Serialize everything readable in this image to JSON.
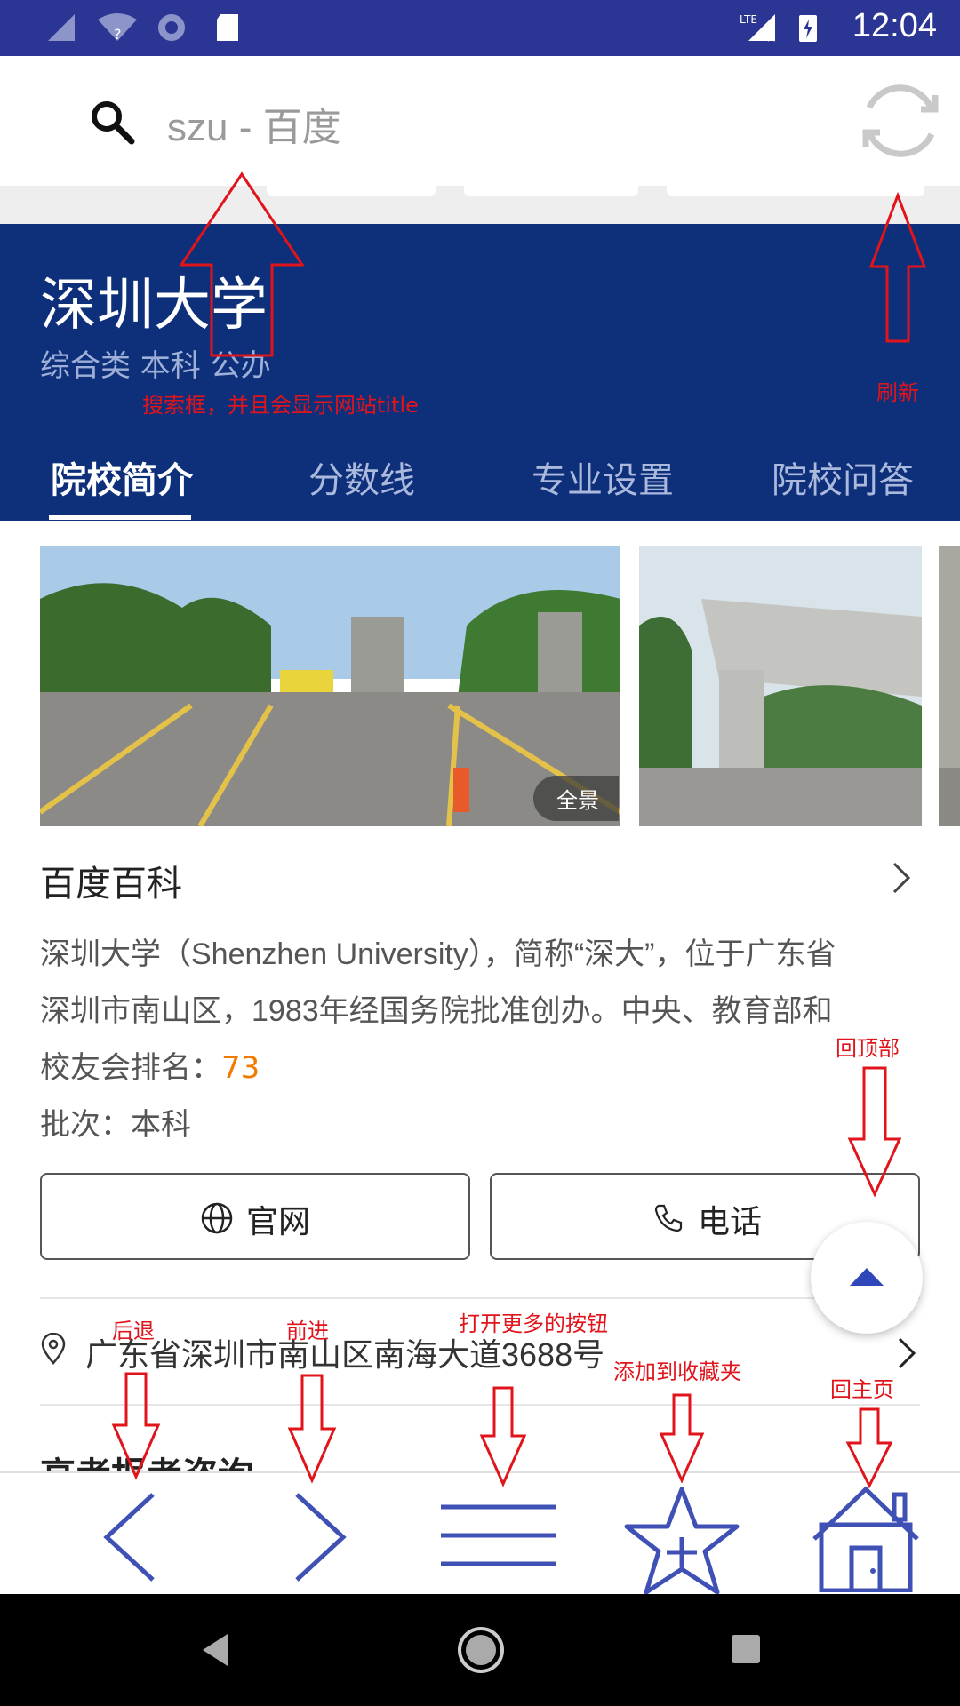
{
  "status_bar": {
    "time": "12:04",
    "network": "LTE"
  },
  "browser": {
    "search_text": "szu - 百度"
  },
  "header": {
    "university_name": "深圳大学",
    "tags": "综合类  本科  公办",
    "tabs": [
      {
        "label": "院校简介"
      },
      {
        "label": "分数线"
      },
      {
        "label": "专业设置"
      },
      {
        "label": "院校问答"
      }
    ]
  },
  "gallery": {
    "panorama_badge": "全景"
  },
  "baike": {
    "title": "百度百科",
    "description_line1": "深圳大学（Shenzhen University），简称“深大”，位于广东省",
    "description_line2": "深圳市南山区，1983年经国务院批准创办。中央、教育部和",
    "rank_label": "校友会排名：",
    "rank_value": "73",
    "batch": "批次：本科"
  },
  "buttons": {
    "website": "官网",
    "phone": "电话"
  },
  "address": "广东省深圳市南山区南海大道3688号",
  "consult_title": "高考报考咨询",
  "annotations": {
    "search": "搜索框，并且会显示网站title",
    "refresh": "刷新",
    "back_to_top": "回顶部",
    "back": "后退",
    "forward": "前进",
    "more": "打开更多的按钮",
    "favorite": "添加到收藏夹",
    "home": "回主页"
  },
  "colors": {
    "status_bar": "#2b3593",
    "header": "#0e2f7a",
    "toolbar_icon": "#3f51b5",
    "annotation": "#e0141b",
    "rank_value": "#f07b00"
  }
}
